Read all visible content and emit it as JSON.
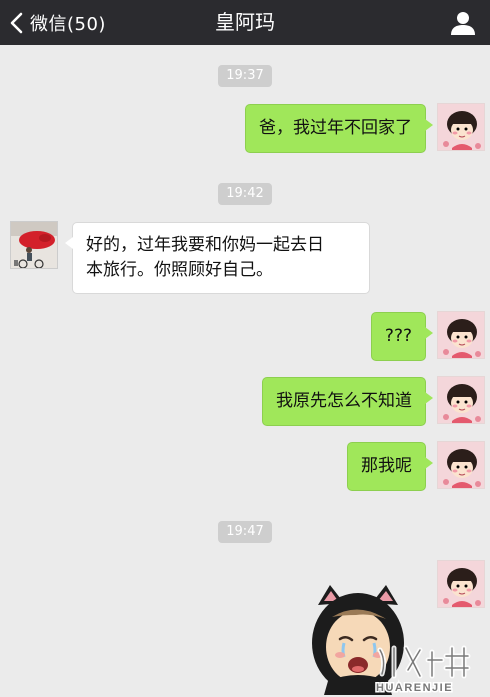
{
  "header": {
    "back_label": "微信(50)",
    "title": "皇阿玛"
  },
  "messages": [
    {
      "type": "timestamp",
      "text": "19:37"
    },
    {
      "type": "sent",
      "text": "爸，我过年不回家了"
    },
    {
      "type": "timestamp",
      "text": "19:42"
    },
    {
      "type": "received",
      "lines": [
        "好的，过年我要和你妈一起去日",
        "本旅行。你照顾好自己。"
      ]
    },
    {
      "type": "sent",
      "text": "???"
    },
    {
      "type": "sent",
      "text": "我原先怎么不知道"
    },
    {
      "type": "sent",
      "text": "那我呢"
    },
    {
      "type": "timestamp",
      "text": "19:47"
    },
    {
      "type": "sent_sticker",
      "sticker": "crying-cat-ear-baby-sticker"
    }
  ],
  "watermark": {
    "brand": "华人街",
    "latin": "HUARENJIE"
  },
  "colors": {
    "topbar": "#2b2b2f",
    "background": "#ebebeb",
    "sent_bubble": "#a0e75a",
    "received_bubble": "#ffffff",
    "timestamp_bg": "#cecece"
  },
  "icons": {
    "back": "chevron-left-icon",
    "profile": "person-icon"
  }
}
